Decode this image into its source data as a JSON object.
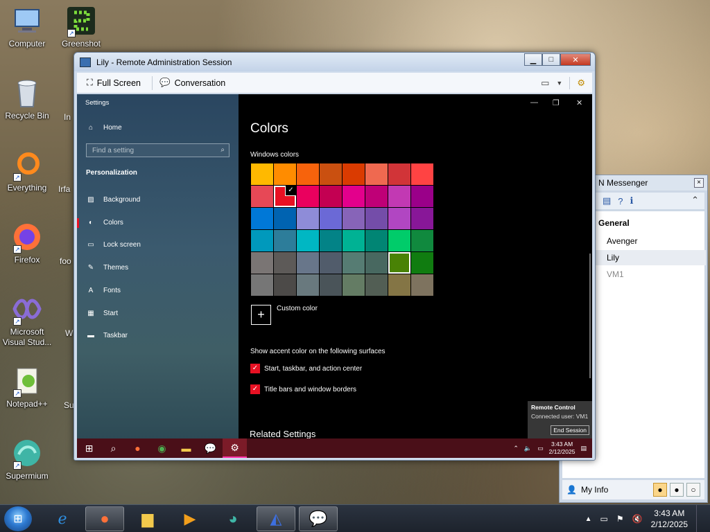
{
  "desktop": {
    "icons": [
      {
        "label": "Computer",
        "icon": "computer-icon"
      },
      {
        "label": "Greenshot",
        "icon": "greenshot-icon"
      },
      {
        "label": "Recycle Bin",
        "icon": "recycle-bin-icon"
      },
      {
        "label": "Everything",
        "icon": "everything-icon"
      },
      {
        "label": "Firefox",
        "icon": "firefox-icon"
      },
      {
        "label": "Microsoft Visual Stud...",
        "icon": "visual-studio-icon"
      },
      {
        "label": "Notepad++",
        "icon": "notepadpp-icon"
      },
      {
        "label": "Supermium",
        "icon": "supermium-icon"
      }
    ],
    "partial_labels": [
      "In",
      "Irfa",
      "foo",
      "W",
      "Su"
    ]
  },
  "remote_window": {
    "title": "Lily - Remote Administration Session",
    "toolbar": {
      "full_screen": "Full Screen",
      "conversation": "Conversation"
    }
  },
  "settings": {
    "caption": "Settings",
    "home": "Home",
    "search_placeholder": "Find a setting",
    "section": "Personalization",
    "nav": [
      "Background",
      "Colors",
      "Lock screen",
      "Themes",
      "Fonts",
      "Start",
      "Taskbar"
    ],
    "page_title": "Colors",
    "windows_colors_label": "Windows colors",
    "swatches": [
      "#ffb900",
      "#ff8c00",
      "#f7630c",
      "#ca5010",
      "#da3b01",
      "#ef6950",
      "#d13438",
      "#ff4343",
      "#e74856",
      "#e81123",
      "#ea005e",
      "#c30052",
      "#e3008c",
      "#bf0077",
      "#c239b3",
      "#9a0089",
      "#0078d7",
      "#0063b1",
      "#8e8cd8",
      "#6b69d6",
      "#8764b8",
      "#744da9",
      "#b146c2",
      "#881798",
      "#0099bc",
      "#2d7d9a",
      "#00b7c3",
      "#038387",
      "#00b294",
      "#018574",
      "#00cc6a",
      "#10893e",
      "#7a7574",
      "#5d5a58",
      "#68768a",
      "#515c6b",
      "#567c73",
      "#486860",
      "#498205",
      "#107c10",
      "#767676",
      "#4c4a48",
      "#69797e",
      "#4a5459",
      "#647c64",
      "#525e54",
      "#847545",
      "#7e735f"
    ],
    "checked_swatch": 9,
    "hover_swatch": 38,
    "custom_color": "Custom color",
    "surfaces_label": "Show accent color on the following surfaces",
    "checkbox_start": "Start, taskbar, and action center",
    "checkbox_titlebars": "Title bars and window borders",
    "related": "Related Settings"
  },
  "remote_control": {
    "title": "Remote Control",
    "connected": "Connected user: VM1",
    "end_session": "End Session"
  },
  "w10_taskbar": {
    "time": "3:43 AM",
    "date": "2/12/2025"
  },
  "messenger": {
    "title": "N Messenger",
    "group": "General",
    "users": [
      "Avenger",
      "Lily",
      "VM1"
    ],
    "my_info": "My Info"
  },
  "taskbar": {
    "time": "3:43 AM",
    "date": "2/12/2025"
  }
}
